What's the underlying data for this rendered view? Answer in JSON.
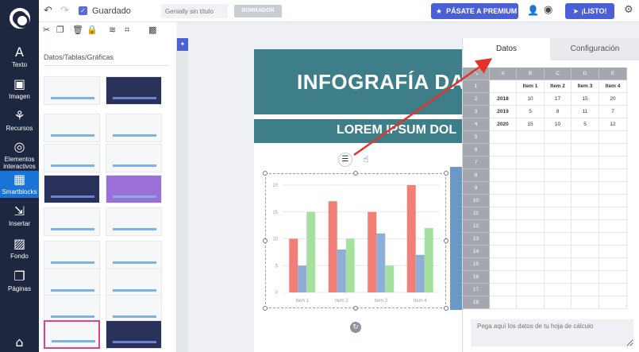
{
  "rail": {
    "items": [
      {
        "label": "Texto",
        "icon": "text-icon",
        "glyph": "A"
      },
      {
        "label": "Imagen",
        "icon": "image-icon",
        "glyph": "▣"
      },
      {
        "label": "Recursos",
        "icon": "resources-icon",
        "glyph": "⚘"
      },
      {
        "label": "Elementos interactivos",
        "icon": "interactive-icon",
        "glyph": "◎"
      },
      {
        "label": "Smartblocks",
        "icon": "smartblocks-icon",
        "glyph": "▦"
      },
      {
        "label": "Insertar",
        "icon": "insert-icon",
        "glyph": "⇲"
      },
      {
        "label": "Fondo",
        "icon": "background-icon",
        "glyph": "▨"
      },
      {
        "label": "Páginas",
        "icon": "pages-icon",
        "glyph": "❐"
      }
    ],
    "bottom_icon": "gift-icon"
  },
  "topbar": {
    "saved_label": "Guardado",
    "title_placeholder": "Genially sin título",
    "clear_label": "BORRADOR",
    "premium_label": "PÁSATE A PREMIUM",
    "done_label": "¡LISTO!"
  },
  "panel": {
    "title": "Datos/Tablas/Gráficas"
  },
  "canvas": {
    "main_title": "INFOGRAFÍA DA",
    "sub_title": "LOREM IPSUM DOL"
  },
  "chart_data": {
    "type": "bar",
    "categories": [
      "Item 1",
      "Item 2",
      "Item 3",
      "Item 4"
    ],
    "series": [
      {
        "name": "2018",
        "color": "#f27f77",
        "values": [
          10,
          17,
          15,
          20
        ]
      },
      {
        "name": "2019",
        "color": "#8eaed6",
        "values": [
          5,
          8,
          11,
          7
        ]
      },
      {
        "name": "2020",
        "color": "#a6e0a0",
        "values": [
          15,
          10,
          5,
          12
        ]
      }
    ],
    "ylim": [
      0,
      20
    ],
    "yticks": [
      0,
      5,
      10,
      15,
      20
    ],
    "grid": true
  },
  "data_panel": {
    "tab_data": "Datos",
    "tab_config": "Configuración",
    "columns": [
      "A",
      "B",
      "C",
      "D",
      "E"
    ],
    "row_numbers": [
      "1",
      "2",
      "3",
      "4",
      "5",
      "6",
      "7",
      "8",
      "9",
      "10",
      "11",
      "12",
      "13",
      "14",
      "15",
      "16",
      "17",
      "18"
    ],
    "rows": [
      [
        "",
        "Item 1",
        "Item 2",
        "Item 3",
        "Item 4"
      ],
      [
        "2018",
        "10",
        "17",
        "15",
        "20"
      ],
      [
        "2019",
        "5",
        "8",
        "11",
        "7"
      ],
      [
        "2020",
        "15",
        "10",
        "5",
        "12"
      ]
    ],
    "paste_placeholder": "Pega aquí los datos de tu hoja de cálculo"
  }
}
